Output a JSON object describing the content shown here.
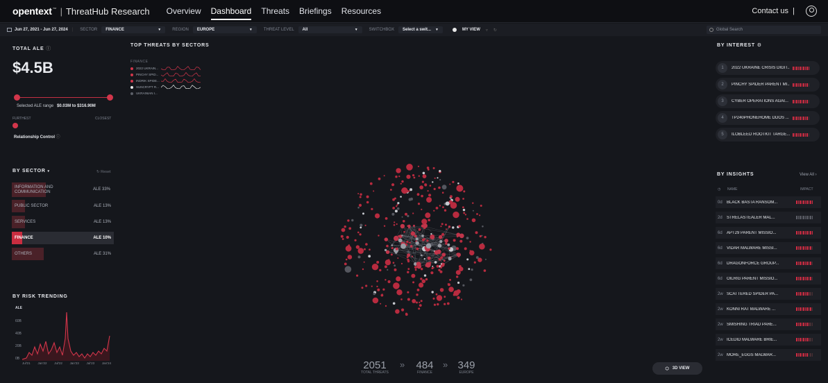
{
  "header": {
    "brand": "opentext",
    "brand_tm": "™",
    "product": "ThreatHub Research",
    "nav": [
      "Overview",
      "Dashboard",
      "Threats",
      "Briefings",
      "Resources"
    ],
    "active_nav": "Dashboard",
    "contact": "Contact us"
  },
  "filters": {
    "date_range": "Jun 27, 2021 - Jun 27, 2024",
    "sector_label": "SECTOR",
    "sector_value": "FINANCE",
    "region_label": "REGION",
    "region_value": "EUROPE",
    "threat_label": "THREAT LEVEL",
    "threat_value": "All",
    "switchbox_label": "SWITCHBOX",
    "switchbox_value": "Select a swit...",
    "my_view": "MY VIEW",
    "search_placeholder": "Global Search"
  },
  "total_ale": {
    "title": "TOTAL ALE",
    "value": "$4.5B",
    "range_label": "Selected ALE range",
    "range_value": "$0.03M to $316.90M",
    "furthest": "FURTHEST",
    "closest": "CLOSEST",
    "relationship": "Relationship Control"
  },
  "top_threats": {
    "title": "TOP THREATS BY SECTORS",
    "sector": "FINANCE",
    "items": [
      {
        "name": "2022 UKRAIN...",
        "color": "#d2364b"
      },
      {
        "name": "PINCHY SPID...",
        "color": "#d2364b"
      },
      {
        "name": "INDRIK SPIDE...",
        "color": "#d2364b"
      },
      {
        "name": "SUNCRYPT R...",
        "color": "#e8e8e8"
      },
      {
        "name": "UKRAINIAN I...",
        "color": "#5c5f68"
      }
    ]
  },
  "by_sector": {
    "title": "BY SECTOR",
    "reset": "Reset",
    "rows": [
      {
        "name": "INFORMATION AND COMMUNICATION",
        "ale": "ALE 33%",
        "pct": 33
      },
      {
        "name": "PUBLIC SECTOR",
        "ale": "ALE 13%",
        "pct": 13
      },
      {
        "name": "SERVICES",
        "ale": "ALE 13%",
        "pct": 13
      },
      {
        "name": "FINANCE",
        "ale": "ALE 10%",
        "pct": 10
      },
      {
        "name": "OTHERS",
        "ale": "ALE 31%",
        "pct": 31
      }
    ]
  },
  "risk_trending": {
    "title": "BY RISK TRENDING",
    "ylabel": "ALE",
    "yticks": [
      "60B",
      "40B",
      "20B",
      "0B"
    ],
    "xticks": [
      "Jul'21",
      "Jan'22",
      "Jul'22",
      "Jan'23",
      "Jul'23",
      "Jan'24"
    ]
  },
  "stats": {
    "total_threats": "2051",
    "total_threats_label": "TOTAL THREATS",
    "finance": "484",
    "finance_label": "FINANCE",
    "europe": "349",
    "europe_label": "EUROPE",
    "view_3d": "3D VIEW"
  },
  "by_interest": {
    "title": "BY INTEREST",
    "items": [
      {
        "num": "1",
        "name": "2022 UKRAINE CRISIS DIGIT...",
        "level": 10
      },
      {
        "num": "2",
        "name": "PINCHY SPIDER PARENT MI...",
        "level": 9
      },
      {
        "num": "3",
        "name": "CYBER OPERATIONS AGAI...",
        "level": 9
      },
      {
        "num": "4",
        "name": "TP240PHONEHOME DDOS ...",
        "level": 9
      },
      {
        "num": "5",
        "name": "ILOBLEED ROOTKIT TARGE...",
        "level": 9
      }
    ]
  },
  "by_insights": {
    "title": "BY INSIGHTS",
    "view_all": "View All",
    "col_name": "NAME",
    "col_impact": "IMPACT",
    "items": [
      {
        "age": "0d",
        "name": "BLACK BASTA RANSOM...",
        "level": 10,
        "grey": false
      },
      {
        "age": "2d",
        "name": "STRELASTEALER MAL...",
        "level": 5,
        "grey": true
      },
      {
        "age": "6d",
        "name": "APT29 PARENT MISSIO...",
        "level": 10,
        "grey": false
      },
      {
        "age": "6d",
        "name": "VIDAR MALWARE MISSI...",
        "level": 9,
        "grey": false
      },
      {
        "age": "6d",
        "name": "DRAGONFORCE GROUP...",
        "level": 9,
        "grey": false
      },
      {
        "age": "6d",
        "name": "OILRIG PARENT MISSIO...",
        "level": 9,
        "grey": false
      },
      {
        "age": "2w",
        "name": "SCATTERED SPIDER PA...",
        "level": 8,
        "grey": false
      },
      {
        "age": "2w",
        "name": "KONNI RAT MALWARE ...",
        "level": 9,
        "grey": false
      },
      {
        "age": "2w",
        "name": "SMISHING TRIAD PARE...",
        "level": 8,
        "grey": false
      },
      {
        "age": "2w",
        "name": "ICEDID MALWARE BRIE...",
        "level": 8,
        "grey": false
      },
      {
        "age": "2w",
        "name": "MORE_EGGS MALWAR...",
        "level": 7,
        "grey": false
      }
    ]
  },
  "colors": {
    "accent": "#d2364b",
    "muted": "#5c5f68",
    "bg": "#15171c"
  }
}
